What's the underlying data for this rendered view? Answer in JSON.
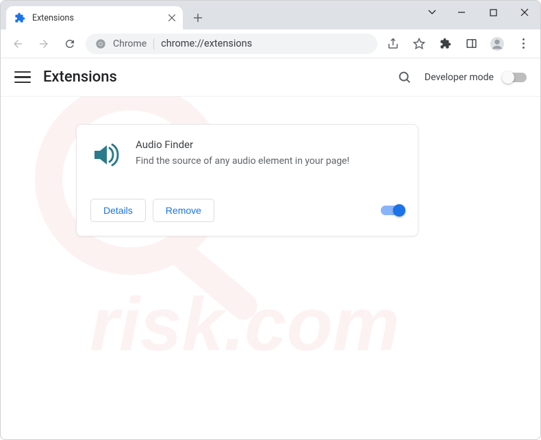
{
  "tab": {
    "title": "Extensions"
  },
  "omnibox": {
    "scheme_label": "Chrome",
    "url": "chrome://extensions"
  },
  "header": {
    "title": "Extensions",
    "dev_mode_label": "Developer mode",
    "dev_mode_on": false
  },
  "extension": {
    "name": "Audio Finder",
    "description": "Find the source of any audio element in your page!",
    "details_label": "Details",
    "remove_label": "Remove",
    "enabled": true
  }
}
